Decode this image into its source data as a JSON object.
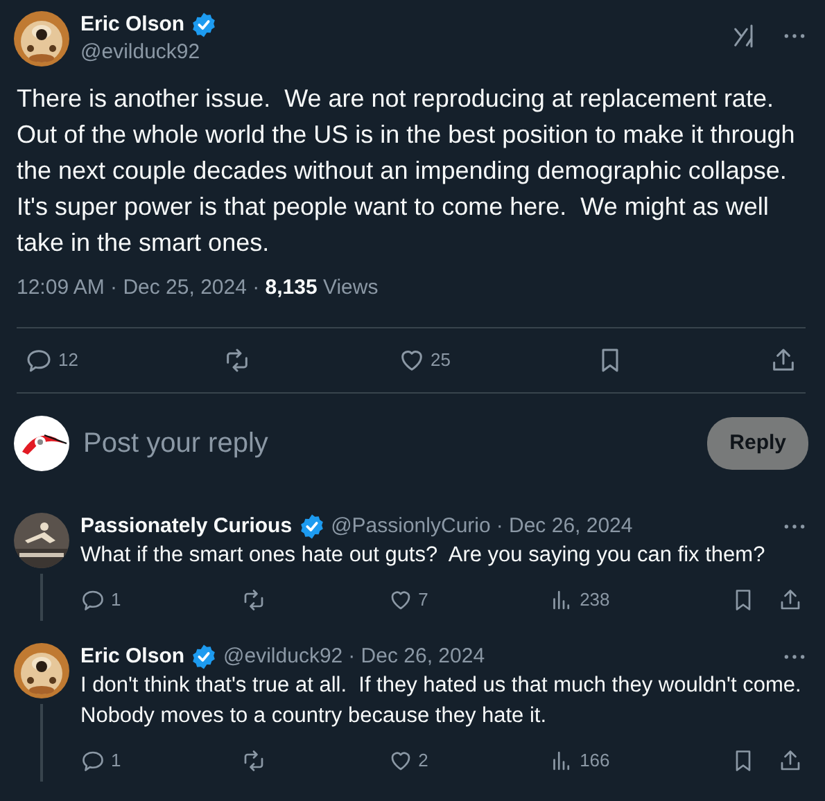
{
  "post": {
    "author": "Eric Olson",
    "verified": true,
    "handle": "@evilduck92",
    "text": "There is another issue.  We are not reproducing at replacement rate.  Out of the whole world the US is in the best position to make it through the next couple decades without an impending demographic collapse.  It's super power is that people want to come here.  We might as well take in the smart ones.",
    "time": "12:09 AM · Dec 25, 2024 · ",
    "views_count": "8,135",
    "views_label": "Views",
    "actions": [
      {
        "kind": "reply",
        "count": "12"
      },
      {
        "kind": "repost"
      },
      {
        "kind": "like",
        "count": "25"
      },
      {
        "kind": "bookmark"
      },
      {
        "kind": "share"
      }
    ]
  },
  "composer": {
    "placeholder": "Post your reply",
    "button": "Reply"
  },
  "replies": [
    {
      "author": "Passionately Curious",
      "verified": true,
      "handle": "@PassionlyCurio",
      "date": "· Dec 26, 2024",
      "thread_line": true,
      "text": "What if the smart ones hate out guts?  Are you saying you can fix them?",
      "actions": [
        {
          "kind": "reply",
          "count": "1"
        },
        {
          "kind": "repost"
        },
        {
          "kind": "like",
          "count": "7"
        },
        {
          "kind": "views",
          "count": "238"
        },
        {
          "kind": "bookmark"
        },
        {
          "kind": "share"
        }
      ]
    },
    {
      "author": "Eric Olson",
      "verified": true,
      "handle": "@evilduck92",
      "date": "· Dec 26, 2024",
      "thread_line": true,
      "text": "I don't think that's true at all.  If they hated us that much they wouldn't come.  Nobody moves to a country because they hate it.",
      "actions": [
        {
          "kind": "reply",
          "count": "1"
        },
        {
          "kind": "repost"
        },
        {
          "kind": "like",
          "count": "2"
        },
        {
          "kind": "views",
          "count": "166"
        },
        {
          "kind": "bookmark"
        },
        {
          "kind": "share"
        }
      ]
    }
  ]
}
